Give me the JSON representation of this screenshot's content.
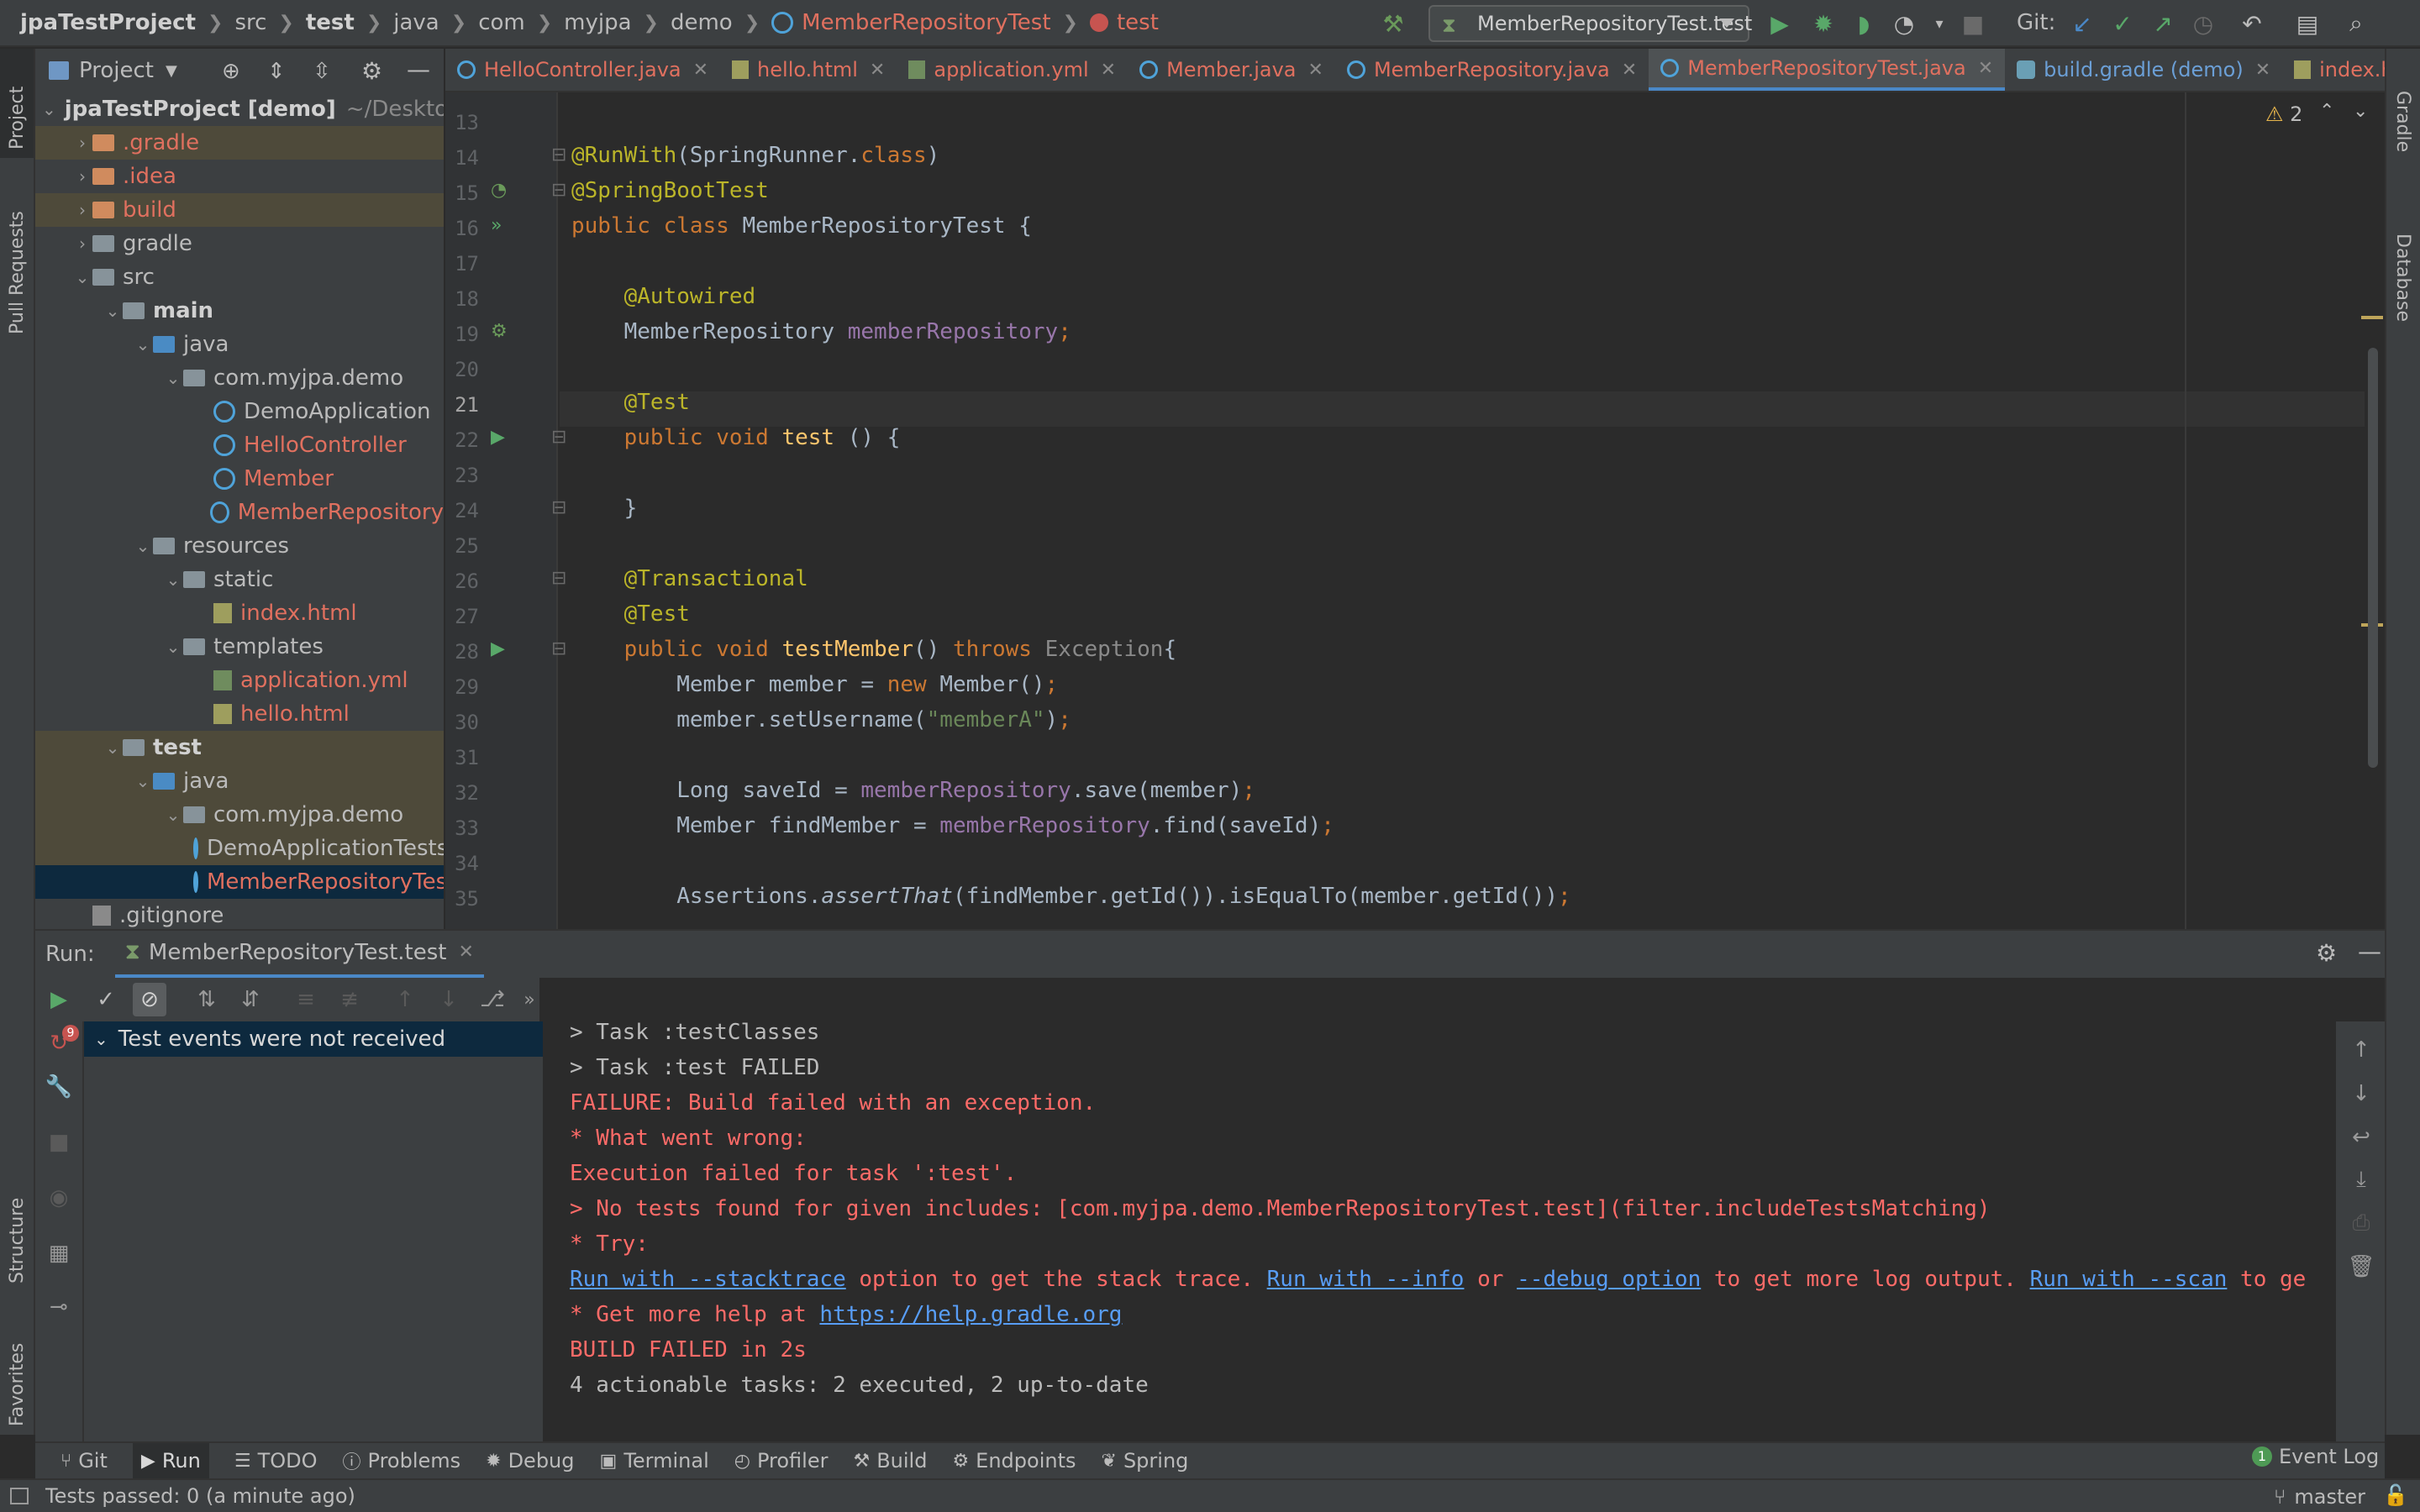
{
  "nav": {
    "project": "jpaTestProject",
    "crumbs": [
      "src",
      "test",
      "java",
      "com",
      "myjpa",
      "demo"
    ],
    "class": "MemberRepositoryTest",
    "method": "test",
    "run_config": "MemberRepositoryTest.test",
    "git_label": "Git:"
  },
  "project_panel": {
    "title": "Project",
    "tree": [
      {
        "label": "jpaTestProject [demo]",
        "suffix": "~/Desktop/pro",
        "level": 0,
        "style": "bold"
      },
      {
        "label": ".gradle",
        "level": 1,
        "style": "red",
        "hl": true
      },
      {
        "label": ".idea",
        "level": 1,
        "style": "red"
      },
      {
        "label": "build",
        "level": 1,
        "style": "red",
        "hl": true
      },
      {
        "label": "gradle",
        "level": 1,
        "style": "norm"
      },
      {
        "label": "src",
        "level": 1,
        "style": "norm"
      },
      {
        "label": "main",
        "level": 2,
        "style": "bold"
      },
      {
        "label": "java",
        "level": 3,
        "style": "norm"
      },
      {
        "label": "com.myjpa.demo",
        "level": 4,
        "style": "norm"
      },
      {
        "label": "DemoApplication",
        "level": 5,
        "style": "norm"
      },
      {
        "label": "HelloController",
        "level": 5,
        "style": "red"
      },
      {
        "label": "Member",
        "level": 5,
        "style": "red"
      },
      {
        "label": "MemberRepository",
        "level": 5,
        "style": "red"
      },
      {
        "label": "resources",
        "level": 3,
        "style": "norm"
      },
      {
        "label": "static",
        "level": 4,
        "style": "norm"
      },
      {
        "label": "index.html",
        "level": 5,
        "style": "red"
      },
      {
        "label": "templates",
        "level": 4,
        "style": "norm"
      },
      {
        "label": "application.yml",
        "level": 5,
        "style": "red"
      },
      {
        "label": "hello.html",
        "level": 5,
        "style": "red"
      },
      {
        "label": "test",
        "level": 2,
        "style": "bold",
        "hl": true
      },
      {
        "label": "java",
        "level": 3,
        "style": "norm",
        "hl": true
      },
      {
        "label": "com.myjpa.demo",
        "level": 4,
        "style": "norm",
        "hl": true
      },
      {
        "label": "DemoApplicationTests",
        "level": 5,
        "style": "norm",
        "hl": true
      },
      {
        "label": "MemberRepositoryTest",
        "level": 5,
        "style": "red",
        "sel": true
      },
      {
        "label": ".gitignore",
        "level": 1,
        "style": "norm"
      }
    ]
  },
  "tabs": [
    {
      "label": "HelloController.java",
      "style": "red"
    },
    {
      "label": "hello.html",
      "style": "red"
    },
    {
      "label": "application.yml",
      "style": "red"
    },
    {
      "label": "Member.java",
      "style": "red"
    },
    {
      "label": "MemberRepository.java",
      "style": "red"
    },
    {
      "label": "MemberRepositoryTest.java",
      "style": "red",
      "active": true
    },
    {
      "label": "build.gradle (demo)",
      "style": "blue"
    },
    {
      "label": "index.html",
      "style": "red"
    }
  ],
  "editor": {
    "warnings": "2",
    "lines": [
      {
        "n": "13",
        "segs": []
      },
      {
        "n": "14",
        "segs": [
          [
            "ann",
            "@RunWith"
          ],
          [
            "",
            "(SpringRunner."
          ],
          [
            "kw",
            "class"
          ],
          [
            "",
            ")"
          ]
        ]
      },
      {
        "n": "15",
        "segs": [
          [
            "ann",
            "@SpringBootTest"
          ]
        ]
      },
      {
        "n": "16",
        "segs": [
          [
            "kw",
            "public class "
          ],
          [
            "",
            "MemberRepositoryTest {"
          ]
        ]
      },
      {
        "n": "17",
        "segs": []
      },
      {
        "n": "18",
        "segs": [
          [
            "",
            "    "
          ],
          [
            "ann",
            "@Autowired"
          ]
        ]
      },
      {
        "n": "19",
        "segs": [
          [
            "",
            "    MemberRepository "
          ],
          [
            "fld",
            "memberRepository"
          ],
          [
            "kw",
            ";"
          ]
        ]
      },
      {
        "n": "20",
        "segs": []
      },
      {
        "n": "21",
        "segs": [
          [
            "",
            "    "
          ],
          [
            "ann",
            "@Test"
          ]
        ]
      },
      {
        "n": "22",
        "segs": [
          [
            "",
            "    "
          ],
          [
            "kw",
            "public void "
          ],
          [
            "fn",
            "test"
          ],
          [
            "",
            " () {"
          ]
        ]
      },
      {
        "n": "23",
        "segs": []
      },
      {
        "n": "24",
        "segs": [
          [
            "",
            "    }"
          ]
        ]
      },
      {
        "n": "25",
        "segs": []
      },
      {
        "n": "26",
        "segs": [
          [
            "",
            "    "
          ],
          [
            "ann",
            "@Transactional"
          ]
        ]
      },
      {
        "n": "27",
        "segs": [
          [
            "",
            "    "
          ],
          [
            "ann",
            "@Test"
          ]
        ]
      },
      {
        "n": "28",
        "segs": [
          [
            "",
            "    "
          ],
          [
            "kw",
            "public void "
          ],
          [
            "fn",
            "testMember"
          ],
          [
            "",
            "() "
          ],
          [
            "kw",
            "throws "
          ],
          [
            "gray",
            "Exception"
          ],
          [
            "",
            "{"
          ]
        ]
      },
      {
        "n": "29",
        "segs": [
          [
            "",
            "        Member member = "
          ],
          [
            "kw",
            "new "
          ],
          [
            "",
            "Member()"
          ],
          [
            "kw",
            ";"
          ]
        ]
      },
      {
        "n": "30",
        "segs": [
          [
            "",
            "        member.setUsername("
          ],
          [
            "str",
            "\"memberA\""
          ],
          [
            "",
            ")"
          ],
          [
            "kw",
            ";"
          ]
        ]
      },
      {
        "n": "31",
        "segs": []
      },
      {
        "n": "32",
        "segs": [
          [
            "",
            "        Long saveId = "
          ],
          [
            "fld",
            "memberRepository"
          ],
          [
            "",
            ".save(member)"
          ],
          [
            "kw",
            ";"
          ]
        ]
      },
      {
        "n": "33",
        "segs": [
          [
            "",
            "        Member findMember = "
          ],
          [
            "fld",
            "memberRepository"
          ],
          [
            "",
            ".find(saveId)"
          ],
          [
            "kw",
            ";"
          ]
        ]
      },
      {
        "n": "34",
        "segs": []
      },
      {
        "n": "35",
        "segs": [
          [
            "",
            "        Assertions."
          ],
          [
            "ital",
            "assertThat"
          ],
          [
            "",
            "(findMember.getId()).isEqualTo(member.getId())"
          ],
          [
            "kw",
            ";"
          ]
        ]
      }
    ]
  },
  "run": {
    "label": "Run:",
    "tab": "MemberRepositoryTest.test",
    "badge": "9",
    "tree_item": "Test events were not received",
    "console": [
      {
        "style": "norm",
        "text": "> Task :testClasses"
      },
      {
        "style": "norm",
        "text": "> Task :test FAILED"
      },
      {
        "style": "red",
        "text": "FAILURE: Build failed with an exception."
      },
      {
        "style": "red",
        "text": "* What went wrong:"
      },
      {
        "style": "red",
        "text": "Execution failed for task ':test'."
      },
      {
        "style": "red",
        "text": "> No tests found for given includes: [com.myjpa.demo.MemberRepositoryTest.test](filter.includeTestsMatching)"
      },
      {
        "style": "red",
        "text": "* Try:"
      },
      {
        "style": "try",
        "parts": [
          [
            "link",
            "Run with --stacktrace"
          ],
          [
            "red",
            " option to get the stack trace. "
          ],
          [
            "link",
            "Run with --info"
          ],
          [
            "red",
            " or "
          ],
          [
            "link",
            "--debug option"
          ],
          [
            "red",
            " to get more log output. "
          ],
          [
            "link",
            "Run with --scan"
          ],
          [
            "red",
            " to ge"
          ]
        ]
      },
      {
        "style": "help",
        "parts": [
          [
            "red",
            "* Get more help at "
          ],
          [
            "link",
            "https://help.gradle.org"
          ]
        ]
      },
      {
        "style": "red",
        "text": "BUILD FAILED in 2s"
      },
      {
        "style": "norm",
        "text": "4 actionable tasks: 2 executed, 2 up-to-date"
      }
    ]
  },
  "left_stripe": [
    "Project",
    "Pull Requests",
    "Structure",
    "Favorites"
  ],
  "right_stripe": [
    "Gradle",
    "Database"
  ],
  "toolstrip": [
    {
      "label": "Git",
      "icon": "git-icon"
    },
    {
      "label": "Run",
      "icon": "run-icon",
      "active": true
    },
    {
      "label": "TODO",
      "icon": "todo-icon"
    },
    {
      "label": "Problems",
      "icon": "problems-icon"
    },
    {
      "label": "Debug",
      "icon": "debug-icon"
    },
    {
      "label": "Terminal",
      "icon": "terminal-icon"
    },
    {
      "label": "Profiler",
      "icon": "profiler-icon"
    },
    {
      "label": "Build",
      "icon": "build-icon"
    },
    {
      "label": "Endpoints",
      "icon": "endpoints-icon"
    },
    {
      "label": "Spring",
      "icon": "spring-icon"
    }
  ],
  "event_log": {
    "count": "1",
    "label": "Event Log"
  },
  "status": {
    "text": "Tests passed: 0 (a minute ago)",
    "branch": "master"
  },
  "colors": {
    "accent": "#4a88c7",
    "error": "#ff6b68",
    "link": "#589df6",
    "modified": "#e0705f"
  }
}
